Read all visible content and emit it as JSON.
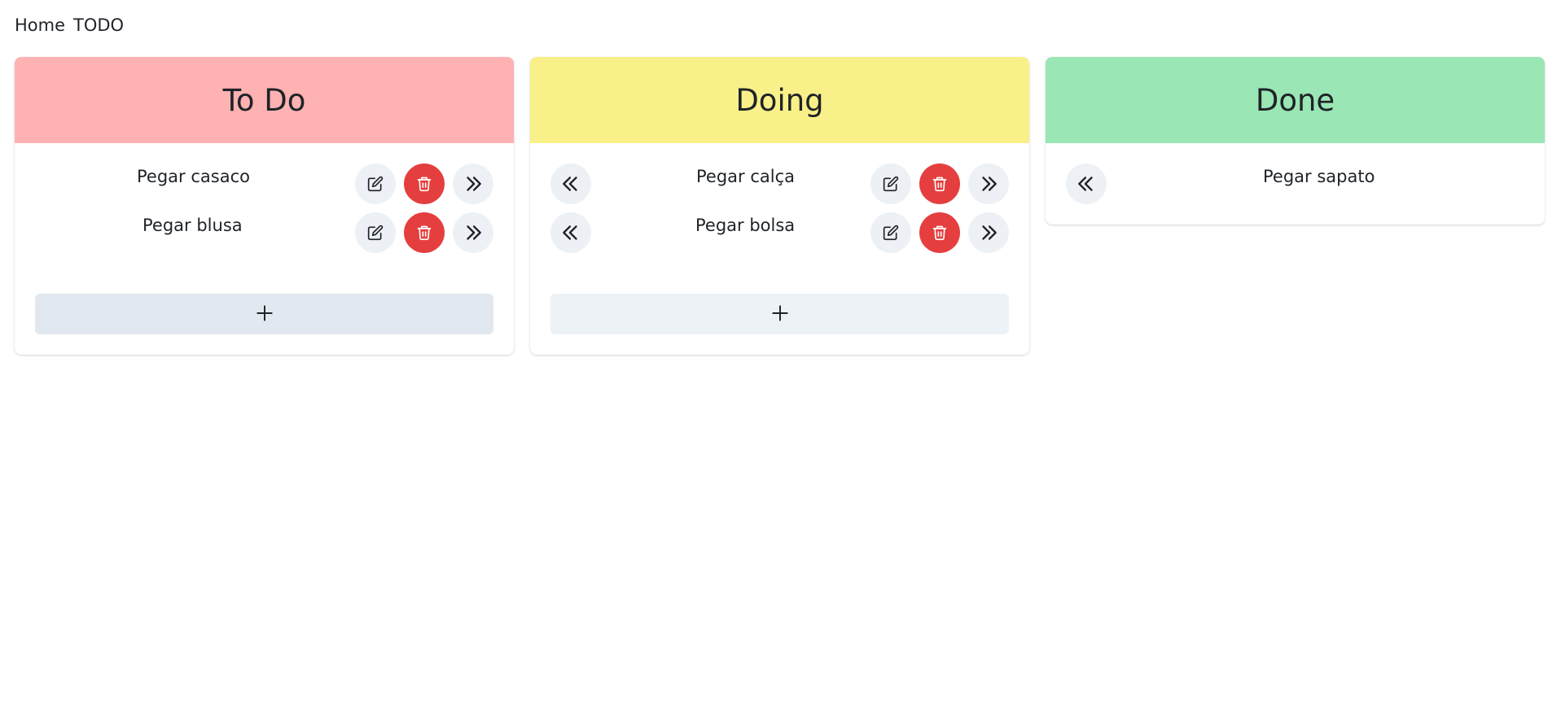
{
  "nav": {
    "home": "Home",
    "todo": "TODO"
  },
  "columns": [
    {
      "title": "To Do",
      "color": "#feb2b2",
      "tasks": [
        {
          "title": "Pegar casaco"
        },
        {
          "title": "Pegar blusa"
        }
      ],
      "add_icon": "plus-icon"
    },
    {
      "title": "Doing",
      "color": "#faf089",
      "tasks": [
        {
          "title": "Pegar calça"
        },
        {
          "title": "Pegar bolsa"
        }
      ],
      "add_icon": "plus-icon"
    },
    {
      "title": "Done",
      "color": "#9ae6b4",
      "tasks": [
        {
          "title": "Pegar sapato"
        }
      ]
    }
  ],
  "icons": {
    "edit": "edit-icon",
    "delete": "trash-icon",
    "forward": "chevrons-right-icon",
    "back": "chevrons-left-icon",
    "add": "plus-icon"
  },
  "colors": {
    "delete": "#e53e3e",
    "icon_button": "#edf1f5",
    "add_button": "#e2e8f0"
  }
}
